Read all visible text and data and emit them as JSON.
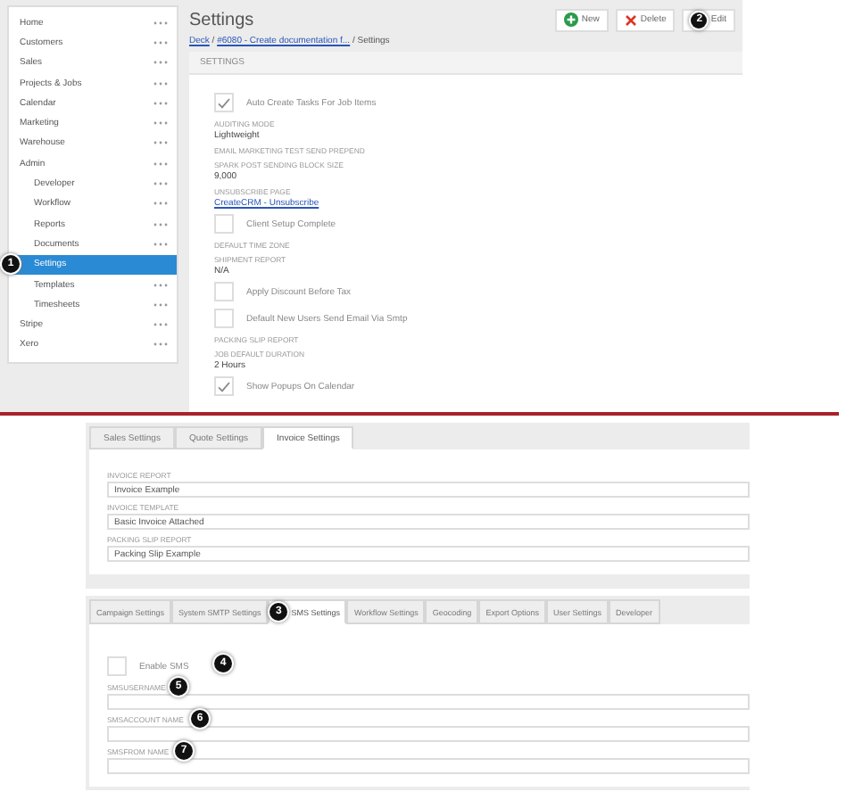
{
  "sidebar": {
    "items": [
      {
        "label": "Home",
        "selected": false
      },
      {
        "label": "Customers",
        "selected": false
      },
      {
        "label": "Sales",
        "selected": false
      },
      {
        "label": "Projects & Jobs",
        "selected": false
      },
      {
        "label": "Calendar",
        "selected": false
      },
      {
        "label": "Marketing",
        "selected": false
      },
      {
        "label": "Warehouse",
        "selected": false
      },
      {
        "label": "Admin",
        "selected": false,
        "children": [
          {
            "label": "Developer",
            "selected": false
          },
          {
            "label": "Workflow",
            "selected": false
          },
          {
            "label": "Reports",
            "selected": false
          },
          {
            "label": "Documents",
            "selected": false
          },
          {
            "label": "Settings",
            "selected": true,
            "callout": "1"
          },
          {
            "label": "Templates",
            "selected": false
          },
          {
            "label": "Timesheets",
            "selected": false
          }
        ]
      },
      {
        "label": "Stripe",
        "selected": false
      },
      {
        "label": "Xero",
        "selected": false
      }
    ]
  },
  "header": {
    "title": "Settings",
    "buttons": [
      {
        "kind": "new",
        "label": "New"
      },
      {
        "kind": "delete",
        "label": "Delete"
      },
      {
        "kind": "edit",
        "label": "Edit",
        "callout": "2"
      }
    ],
    "breadcrumb": [
      {
        "text": "Deck",
        "link": true
      },
      {
        "text": " / ",
        "link": false
      },
      {
        "text": "#6080 - Create documentation f...",
        "link": true
      },
      {
        "text": " / Settings",
        "link": false
      }
    ]
  },
  "settings": {
    "title": "SETTINGS",
    "fields": [
      {
        "kind": "checkbox",
        "label": "Auto Create Tasks For Job Items",
        "checked": true
      },
      {
        "kind": "text",
        "label": "AUDITING MODE",
        "value": "Lightweight"
      },
      {
        "kind": "text",
        "label": "EMAIL MARKETING TEST SEND PREPEND"
      },
      {
        "kind": "text",
        "label": "SPARK POST SENDING BLOCK SIZE",
        "value": "9,000"
      },
      {
        "kind": "link",
        "label": "UNSUBSCRIBE PAGE",
        "value": "CreateCRM - Unsubscribe"
      },
      {
        "kind": "checkbox",
        "label": "Client Setup Complete",
        "checked": false
      },
      {
        "kind": "text",
        "label": "DEFAULT TIME ZONE"
      },
      {
        "kind": "text",
        "label": "SHIPMENT REPORT",
        "value": "N/A"
      },
      {
        "kind": "checkbox",
        "label": "Apply Discount Before Tax",
        "checked": false
      },
      {
        "kind": "checkbox",
        "label": "Default New Users Send Email Via Smtp",
        "checked": false
      },
      {
        "kind": "text",
        "label": "PACKING SLIP REPORT"
      },
      {
        "kind": "text",
        "label": "JOB DEFAULT DURATION",
        "value": "2 Hours"
      },
      {
        "kind": "checkbox",
        "label": "Show Popups On Calendar",
        "checked": true
      }
    ]
  },
  "panels": [
    {
      "tabs": [
        {
          "label": "Sales Settings",
          "selected": false
        },
        {
          "label": "Quote Settings",
          "selected": false
        },
        {
          "label": "Invoice Settings",
          "selected": true
        }
      ],
      "fields": [
        {
          "kind": "input",
          "label": "INVOICE REPORT",
          "value": "Invoice Example"
        },
        {
          "kind": "input",
          "label": "INVOICE TEMPLATE",
          "value": "Basic Invoice Attached"
        },
        {
          "kind": "input",
          "label": "PACKING SLIP REPORT",
          "value": "Packing Slip Example"
        }
      ]
    },
    {
      "tabs": [
        {
          "label": "Campaign Settings",
          "selected": false
        },
        {
          "label": "System SMTP Settings",
          "selected": false
        },
        {
          "label": "SMS Settings",
          "selected": true,
          "callout": "3"
        },
        {
          "label": "Workflow Settings",
          "selected": false
        },
        {
          "label": "Geocoding",
          "selected": false
        },
        {
          "label": "Export Options",
          "selected": false
        },
        {
          "label": "User Settings",
          "selected": false
        },
        {
          "label": "Developer",
          "selected": false
        }
      ],
      "fields": [
        {
          "kind": "checkbox",
          "label": "Enable SMS",
          "checked": false,
          "callout": "4"
        },
        {
          "kind": "input",
          "label": "SMSUSERNAME",
          "callout": "5"
        },
        {
          "kind": "input",
          "label": "SMSACCOUNT NAME",
          "callout": "6"
        },
        {
          "kind": "input",
          "label": "SMSFROM NAME",
          "callout": "7"
        }
      ]
    }
  ]
}
